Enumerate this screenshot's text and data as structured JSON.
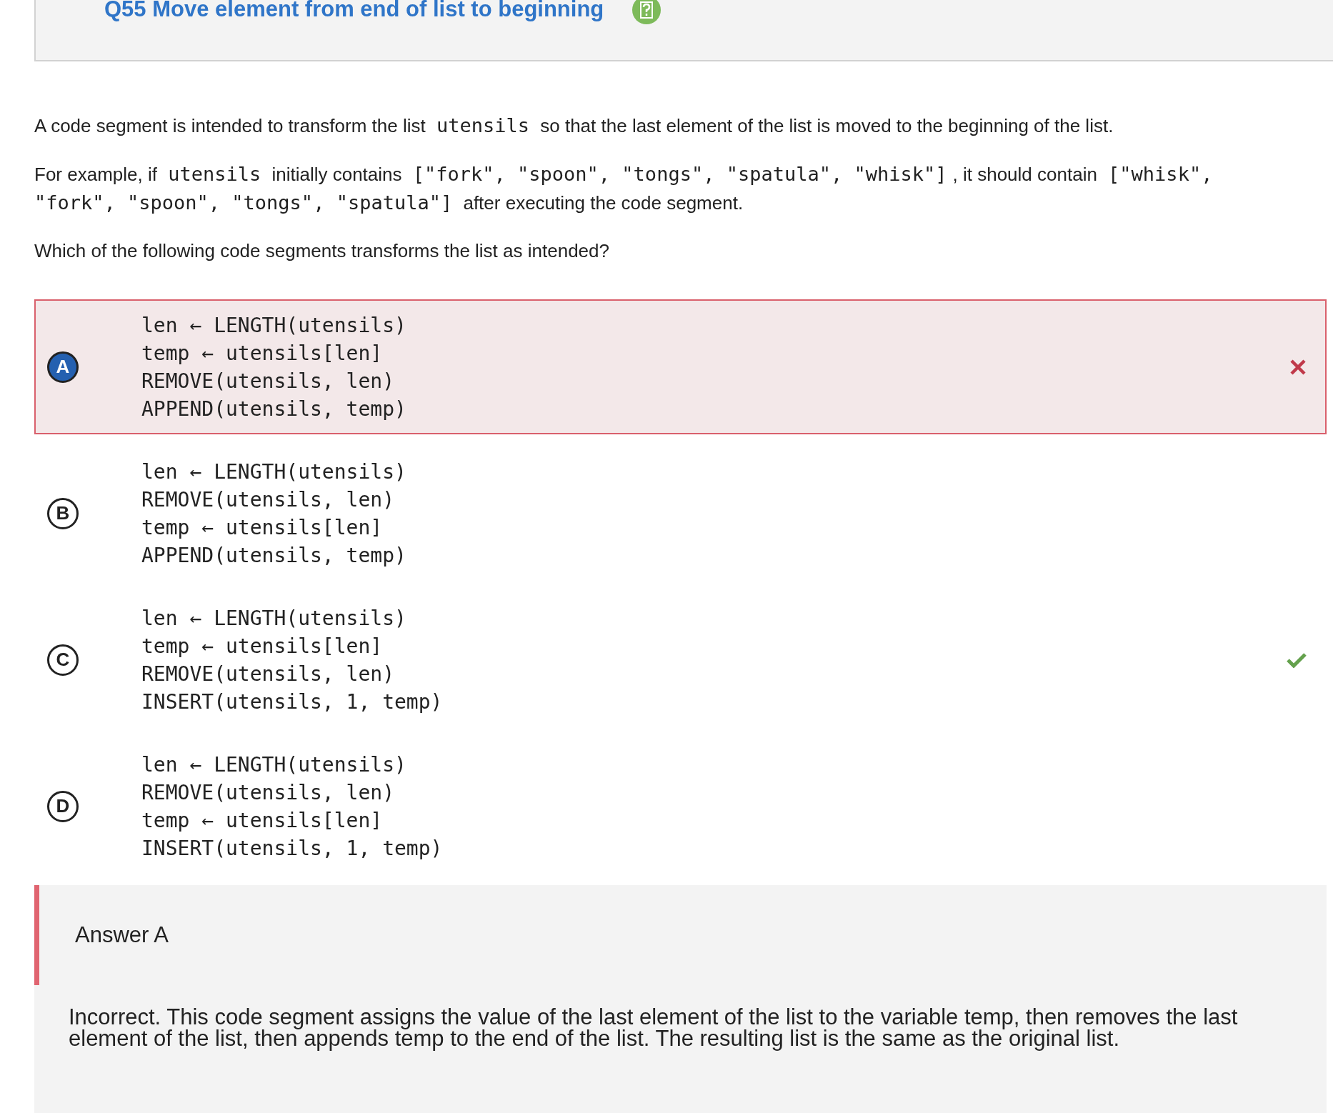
{
  "header": {
    "title": "Q55 Move element from end of list to beginning"
  },
  "prompt": [
    [
      {
        "kind": "text",
        "text": "A code segment is intended to transform the list "
      },
      {
        "kind": "code",
        "text": "utensils"
      },
      {
        "kind": "text",
        "text": " so that the last element of the list is moved to the beginning of the list."
      }
    ],
    [
      {
        "kind": "text",
        "text": "For example, if "
      },
      {
        "kind": "code",
        "text": "utensils"
      },
      {
        "kind": "text",
        "text": " initially contains "
      },
      {
        "kind": "code",
        "text": "[\"fork\", \"spoon\", \"tongs\", \"spatula\", \"whisk\"]"
      },
      {
        "kind": "text",
        "text": ", it should contain "
      },
      {
        "kind": "code",
        "text": "[\"whisk\", \"fork\", \"spoon\", \"tongs\", \"spatula\"]"
      },
      {
        "kind": "text",
        "text": " after executing the code segment."
      }
    ],
    [
      {
        "kind": "text",
        "text": "Which of the following code segments transforms the list as intended?"
      }
    ]
  ],
  "choices": [
    {
      "letter": "A",
      "selected": true,
      "kind": "incorrect",
      "lines": [
        "len ← LENGTH(utensils)",
        "temp ← utensils[len]",
        "REMOVE(utensils, len)",
        "APPEND(utensils, temp)"
      ]
    },
    {
      "letter": "B",
      "selected": false,
      "kind": "plain",
      "lines": [
        "len ← LENGTH(utensils)",
        "REMOVE(utensils, len)",
        "temp ← utensils[len]",
        "APPEND(utensils, temp)"
      ]
    },
    {
      "letter": "C",
      "selected": false,
      "kind": "correct",
      "lines": [
        "len ← LENGTH(utensils)",
        "temp ← utensils[len]",
        "REMOVE(utensils, len)",
        "INSERT(utensils, 1, temp)"
      ]
    },
    {
      "letter": "D",
      "selected": false,
      "kind": "plain",
      "lines": [
        "len ← LENGTH(utensils)",
        "REMOVE(utensils, len)",
        "temp ← utensils[len]",
        "INSERT(utensils, 1, temp)"
      ]
    }
  ],
  "feedback": {
    "heading": "Answer A",
    "text": "Incorrect. This code segment assigns the value of the last element of the list to the variable temp, then removes the last element of the list, then appends temp to the end of the list. The resulting list is the same as the original list."
  }
}
